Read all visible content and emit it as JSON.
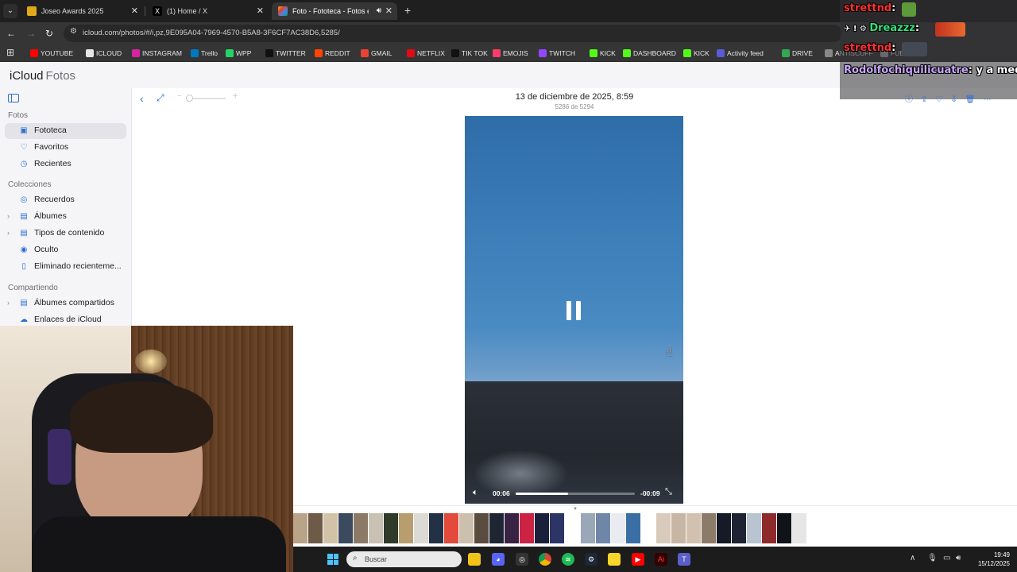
{
  "browser": {
    "tabs": [
      {
        "title": "Joseo Awards 2025",
        "active": false
      },
      {
        "title": "(1) Home / X",
        "active": false
      },
      {
        "title": "Foto - Fototeca - Fotos en iCloud",
        "active": true
      }
    ],
    "url": "icloud.com/photos/#/i,pz,9E095A04-7969-4570-B5A8-3F6CF7AC38D6,5285/",
    "bookmarks": [
      {
        "label": "YOUTUBE",
        "color": "#ff0000"
      },
      {
        "label": "ICLOUD",
        "color": "#e6e6e6"
      },
      {
        "label": "INSTAGRAM",
        "color": "#d6249f"
      },
      {
        "label": "Trello",
        "color": "#0079bf"
      },
      {
        "label": "WPP",
        "color": "#25d366"
      },
      {
        "label": "TWITTER",
        "color": "#111111"
      },
      {
        "label": "REDDIT",
        "color": "#ff4500"
      },
      {
        "label": "GMAIL",
        "color": "#ea4335"
      },
      {
        "label": "NETFLIX",
        "color": "#e50914"
      },
      {
        "label": "TIK TOK",
        "color": "#111111"
      },
      {
        "label": "EMOJIS",
        "color": "#ff3b6b"
      },
      {
        "label": "TWITCH",
        "color": "#9146ff"
      },
      {
        "label": "KICK",
        "color": "#53fc18"
      },
      {
        "label": "DASHBOARD",
        "color": "#53fc18"
      },
      {
        "label": "KICK",
        "color": "#53fc18"
      },
      {
        "label": "Activity feed",
        "color": "#5b5bd6"
      },
      {
        "label": "DRIVE",
        "color": "#34a853"
      },
      {
        "label": "ANTISCUFF",
        "color": "#888888"
      },
      {
        "label": "FUENTES",
        "color": "#aaaaaa"
      }
    ]
  },
  "icloud": {
    "brand": "iCloud",
    "app": "Fotos"
  },
  "sidebar": {
    "sections": [
      "Fotos",
      "Colecciones",
      "Compartiendo"
    ],
    "items": [
      {
        "label": "Fototeca",
        "icon": "photo-library-icon",
        "glyph": "▣",
        "selected": true,
        "chevron": false
      },
      {
        "label": "Favoritos",
        "icon": "heart-icon",
        "glyph": "♡",
        "selected": false,
        "chevron": false
      },
      {
        "label": "Recientes",
        "icon": "clock-icon",
        "glyph": "◷",
        "selected": false,
        "chevron": false
      },
      {
        "label": "Recuerdos",
        "icon": "memories-icon",
        "glyph": "◎",
        "selected": false,
        "chevron": false
      },
      {
        "label": "Álbumes",
        "icon": "albums-icon",
        "glyph": "▤",
        "selected": false,
        "chevron": true
      },
      {
        "label": "Tipos de contenido",
        "icon": "media-types-icon",
        "glyph": "▤",
        "selected": false,
        "chevron": true
      },
      {
        "label": "Oculto",
        "icon": "eye-slash-icon",
        "glyph": "◉",
        "selected": false,
        "chevron": false
      },
      {
        "label": "Eliminado recienteme...",
        "icon": "trash-icon",
        "glyph": "▯",
        "selected": false,
        "chevron": false
      },
      {
        "label": "Álbumes compartidos",
        "icon": "shared-albums-icon",
        "glyph": "▤",
        "selected": false,
        "chevron": true
      },
      {
        "label": "Enlaces de iCloud",
        "icon": "cloud-link-icon",
        "glyph": "☁",
        "selected": false,
        "chevron": false
      }
    ]
  },
  "viewer": {
    "date": "13 de diciembre de 2025, 8:59",
    "count": "5286 de 5294",
    "elapsed": "00:06",
    "remaining": "-00:09",
    "progress": 0.44
  },
  "filmstrip": {
    "thumbs": [
      "#b9a48a",
      "#6d5a47",
      "#d2c3a8",
      "#3b4a5e",
      "#8a7a66",
      "#c9c2b4",
      "#2f3b2a",
      "#b89d6e",
      "#dcdad4",
      "#233146",
      "#e34a3c",
      "#cbbfae",
      "#5a4c3f",
      "#1f2633",
      "#382345",
      "#cc2244",
      "#1a1f3a",
      "#2c3566",
      "#9aa7b8",
      "#6f86a8",
      "#e8ecf0",
      "#3a6fa6",
      "#ffffff",
      "#d9cbbb",
      "#c8b6a4",
      "#d3c1af",
      "#8d7b69",
      "#151a26",
      "#1d2333",
      "#b8c4d0",
      "#8e2a2a",
      "#101418",
      "#e6e6e6"
    ]
  },
  "taskbar": {
    "search_placeholder": "Buscar",
    "time": "19:49",
    "date": "15/12/2025"
  },
  "chat": {
    "lines": [
      {
        "user": "strettnd",
        "msg": ""
      },
      {
        "user": "Dreazzz",
        "msg": ""
      },
      {
        "user": "strettnd",
        "msg": ""
      },
      {
        "user": "Rodolfochiquilicuatre",
        "msg": "y a meditar"
      }
    ]
  }
}
